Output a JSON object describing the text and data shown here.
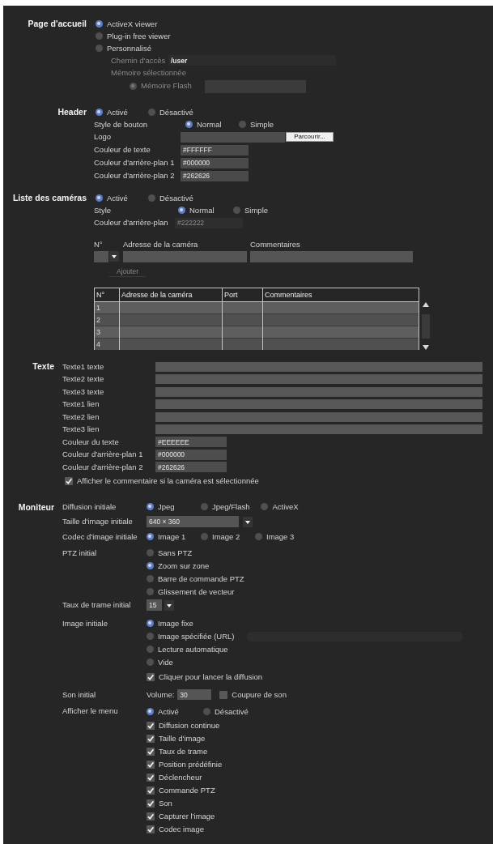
{
  "page_accueil": {
    "label": "Page d'accueil",
    "options": [
      {
        "label": "ActiveX viewer",
        "selected": true
      },
      {
        "label": "Plug-in free viewer",
        "selected": false
      },
      {
        "label": "Personnalisé",
        "selected": false
      }
    ],
    "custom": {
      "disabled": true,
      "path_label": "Chemin d'accès",
      "path_value": "/user",
      "memory_label": "Mémoire sélectionnée",
      "flash": {
        "label": "Mémoire Flash",
        "selected": true
      }
    }
  },
  "header": {
    "label": "Header",
    "options": [
      {
        "label": "Activé",
        "selected": true
      },
      {
        "label": "Désactivé",
        "selected": false
      }
    ],
    "button_style": {
      "label": "Style de bouton",
      "options": [
        {
          "label": "Normal",
          "selected": true
        },
        {
          "label": "Simple",
          "selected": false
        }
      ]
    },
    "logo": {
      "label": "Logo",
      "button": "Parcourir..."
    },
    "colors": [
      {
        "label": "Couleur de texte",
        "value": "#FFFFFF"
      },
      {
        "label": "Couleur d'arrière-plan 1",
        "value": "#000000"
      },
      {
        "label": "Couleur d'arrière-plan 2",
        "value": "#262626"
      }
    ]
  },
  "camera_list": {
    "label": "Liste des caméras",
    "options": [
      {
        "label": "Activé",
        "selected": true
      },
      {
        "label": "Désactivé",
        "selected": false
      }
    ],
    "style": {
      "label": "Style",
      "options": [
        {
          "label": "Normal",
          "selected": true
        },
        {
          "label": "Simple",
          "selected": false
        }
      ]
    },
    "background": {
      "label": "Couleur d'arrière-plan",
      "value": "#222222",
      "disabled": true
    },
    "entry": {
      "columns": [
        "N°",
        "Adresse de la caméra",
        "Commentaires"
      ],
      "add_button": {
        "label": "Ajouter",
        "disabled": true
      }
    },
    "table": {
      "columns": [
        "N°",
        "Adresse de la caméra",
        "Port",
        "Commentaires"
      ],
      "rows": [
        {
          "number": "1"
        },
        {
          "number": "2"
        },
        {
          "number": "3"
        },
        {
          "number": "4"
        }
      ]
    }
  },
  "texte": {
    "label": "Texte",
    "fields": [
      {
        "label": "Texte1 texte"
      },
      {
        "label": "Texte2 texte"
      },
      {
        "label": "Texte3 texte"
      },
      {
        "label": "Texte1 lien"
      },
      {
        "label": "Texte2 lien"
      },
      {
        "label": "Texte3 lien"
      }
    ],
    "colors": [
      {
        "label": "Couleur du texte",
        "value": "#EEEEEE"
      },
      {
        "label": "Couleur d'arrière-plan 1",
        "value": "#000000"
      },
      {
        "label": "Couleur d'arrière-plan 2",
        "value": "#262626"
      }
    ],
    "show_comment": {
      "label": "Afficher le commentaire si la caméra est sélectionnée",
      "checked": true
    }
  },
  "moniteur": {
    "label": "Moniteur",
    "rows": [
      {
        "kind": "radio_inline",
        "label": "Diffusion initiale",
        "options": [
          {
            "label": "Jpeg",
            "selected": true
          },
          {
            "label": "Jpeg/Flash",
            "selected": false
          },
          {
            "label": "ActiveX",
            "selected": false
          }
        ]
      },
      {
        "kind": "select",
        "label": "Taille d'image initiale",
        "value": "640 × 360"
      },
      {
        "kind": "radio_inline",
        "label": "Codec d'image initiale",
        "options": [
          {
            "label": "Image 1",
            "selected": true
          },
          {
            "label": "Image 2",
            "selected": false
          },
          {
            "label": "Image 3",
            "selected": false
          }
        ]
      },
      {
        "kind": "radio_stack",
        "label": "PTZ initial",
        "options": [
          {
            "label": "Sans PTZ",
            "selected": false
          },
          {
            "label": "Zoom sur zone",
            "selected": true
          },
          {
            "label": "Barre de commande PTZ",
            "selected": false
          },
          {
            "label": "Glissement de vecteur",
            "selected": false
          }
        ]
      },
      {
        "kind": "select",
        "label": "Taux de trame initial",
        "value": "15"
      },
      {
        "kind": "image",
        "label": "Image initiale",
        "options": [
          {
            "label": "Image fixe",
            "selected": true
          },
          {
            "label": "Image spécifiée (URL)",
            "selected": false,
            "field": true
          },
          {
            "label": "Lecture automatique",
            "selected": false
          },
          {
            "label": "Vide",
            "selected": false
          }
        ],
        "click_to_play": {
          "label": "Cliquer pour lancer la diffusion",
          "checked": true
        }
      },
      {
        "kind": "sound",
        "label": "Son initial",
        "volume_label": "Volume:",
        "volume": "30",
        "mute": {
          "label": "Coupure de son",
          "checked": false
        }
      },
      {
        "kind": "menu",
        "label": "Afficher le menu",
        "options": [
          {
            "label": "Activé",
            "selected": true
          },
          {
            "label": "Désactivé",
            "selected": false
          }
        ],
        "items": [
          {
            "label": "Diffusion continue",
            "checked": true
          },
          {
            "label": "Taille d'image",
            "checked": true
          },
          {
            "label": "Taux de trame",
            "checked": true
          },
          {
            "label": "Position prédéfinie",
            "checked": true
          },
          {
            "label": "Déclencheur",
            "checked": true
          },
          {
            "label": "Commande PTZ",
            "checked": true
          },
          {
            "label": "Son",
            "checked": true
          },
          {
            "label": "Capturer l'image",
            "checked": true
          },
          {
            "label": "Codec image",
            "checked": true
          }
        ]
      }
    ]
  }
}
